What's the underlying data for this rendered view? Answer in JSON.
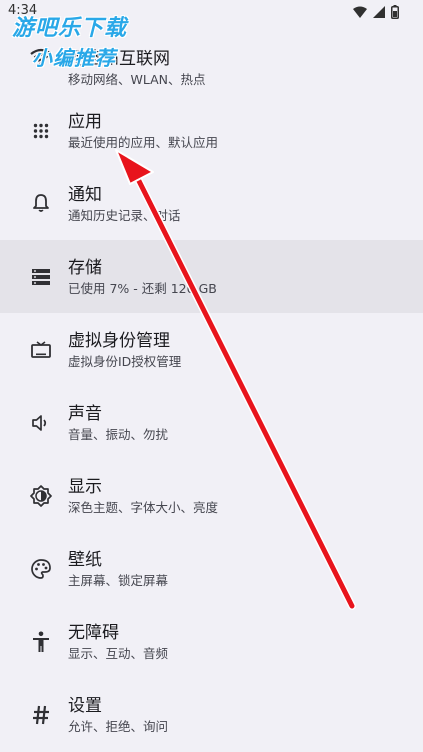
{
  "status_bar": {
    "time": "4:34",
    "icons": [
      "wifi-icon",
      "signal-icon",
      "battery-icon"
    ]
  },
  "watermark": {
    "line1": "游吧乐下载",
    "line2": "小编推荐"
  },
  "settings": {
    "items": [
      {
        "icon": "wifi-icon",
        "title": "网络和互联网",
        "subtitle": "移动网络、WLAN、热点"
      },
      {
        "icon": "apps-grid-icon",
        "title": "应用",
        "subtitle": "最近使用的应用、默认应用"
      },
      {
        "icon": "bell-icon",
        "title": "通知",
        "subtitle": "通知历史记录、对话"
      },
      {
        "icon": "storage-icon",
        "title": "存储",
        "subtitle": "已使用 7% - 还剩 120 GB"
      },
      {
        "icon": "tv-icon",
        "title": "虚拟身份管理",
        "subtitle": "虚拟身份ID授权管理"
      },
      {
        "icon": "volume-icon",
        "title": "声音",
        "subtitle": "音量、振动、勿扰"
      },
      {
        "icon": "brightness-icon",
        "title": "显示",
        "subtitle": "深色主题、字体大小、亮度"
      },
      {
        "icon": "palette-icon",
        "title": "壁纸",
        "subtitle": "主屏幕、锁定屏幕"
      },
      {
        "icon": "accessibility-icon",
        "title": "无障碍",
        "subtitle": "显示、互动、音频"
      },
      {
        "icon": "hash-icon",
        "title": "设置",
        "subtitle": "允许、拒绝、询问"
      }
    ]
  },
  "colors": {
    "background": "#f1f0f6",
    "highlight_row": "#e4e3e9",
    "annotation_arrow": "#e8141c",
    "watermark": "#29a8e8"
  }
}
